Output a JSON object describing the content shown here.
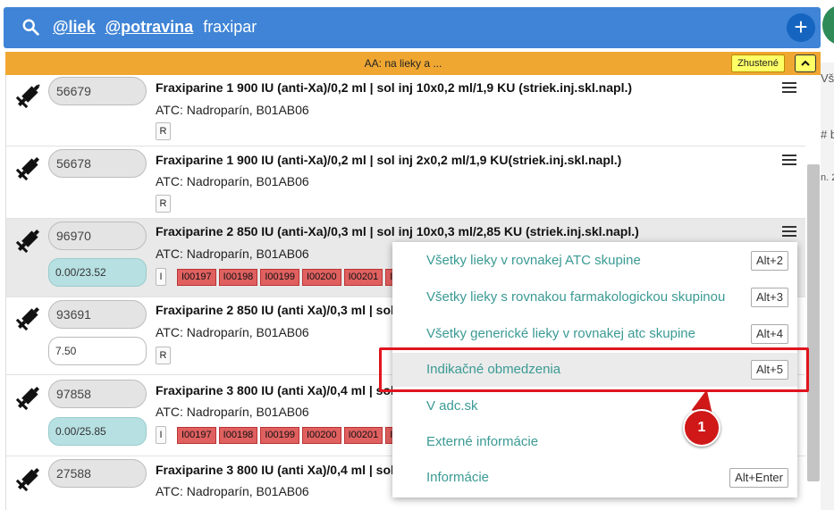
{
  "search": {
    "tags": [
      "@liek",
      "@potravina"
    ],
    "query": "fraxipar"
  },
  "filter": {
    "text": "AA: na lieky a ...",
    "compact_label": "Zhustené"
  },
  "background": {
    "frag_1": "Vš",
    "frag_2": "# b",
    "frag_3": "n. 2"
  },
  "rows": [
    {
      "code": "56679",
      "name": "Fraxiparine 1 900 IU (anti-Xa)/0,2 ml | sol inj 10x0,2 ml/1,9 KU (striek.inj.skl.napl.)",
      "atc": "ATC: Nadroparín, B01AB06",
      "badge": "R"
    },
    {
      "code": "56678",
      "name": "Fraxiparine 1 900 IU (anti-Xa)/0,2 ml | sol inj 2x0,2 ml/1,9 KU(striek.inj.skl.napl.)",
      "atc": "ATC: Nadroparín, B01AB06",
      "badge": "R"
    },
    {
      "code": "96970",
      "price": "0.00/23.52",
      "name": "Fraxiparine 2 850 IU (anti-Xa)/0,3 ml | sol inj 10x0,3 ml/2,85 KU (striek.inj.skl.napl.)",
      "atc": "ATC: Nadroparín, B01AB06",
      "badge": "I",
      "indications": [
        "I00197",
        "I00198",
        "I00199",
        "I00200",
        "I00201",
        "I0"
      ]
    },
    {
      "code": "93691",
      "price": "7.50",
      "name": "Fraxiparine 2 850 IU (anti Xa)/0,3 ml | sol",
      "atc": "ATC: Nadroparín, B01AB06",
      "badge": "R"
    },
    {
      "code": "97858",
      "price": "0.00/25.85",
      "name": "Fraxiparine 3 800 IU (anti Xa)/0,4 ml | sol",
      "atc": "ATC: Nadroparín, B01AB06",
      "badge": "I",
      "indications": [
        "I00197",
        "I00198",
        "I00199",
        "I00200",
        "I00201",
        "I"
      ]
    },
    {
      "code": "27588",
      "name": "Fraxiparine 3 800 IU (anti Xa)/0,4 ml | sol",
      "atc": "ATC: Nadroparín, B01AB06"
    }
  ],
  "context_menu": {
    "items": [
      {
        "label": "Všetky lieky v rovnakej ATC skupine",
        "shortcut": "Alt+2"
      },
      {
        "label": "Všetky lieky s rovnakou farmakologickou skupinou",
        "shortcut": "Alt+3"
      },
      {
        "label": "Všetky generické lieky v rovnakej atc skupine",
        "shortcut": "Alt+4"
      },
      {
        "label": "Indikačné obmedzenia",
        "shortcut": "Alt+5"
      },
      {
        "label": "V adc.sk",
        "shortcut": ""
      },
      {
        "label": "Externé informácie",
        "shortcut": ""
      },
      {
        "label": "Informácie",
        "shortcut": "Alt+Enter"
      }
    ],
    "hovered_index": 3
  },
  "annotation": {
    "callout_number": "1"
  },
  "colors": {
    "search_bar": "#3f84d6",
    "filter_strip": "#f0a732",
    "menu_text": "#3a9a94",
    "indication": "#e06060",
    "highlight": "#e0141e"
  },
  "icons": [
    "search-icon",
    "add-icon",
    "syringe-icon",
    "menu-icon",
    "chevron-up-icon"
  ]
}
